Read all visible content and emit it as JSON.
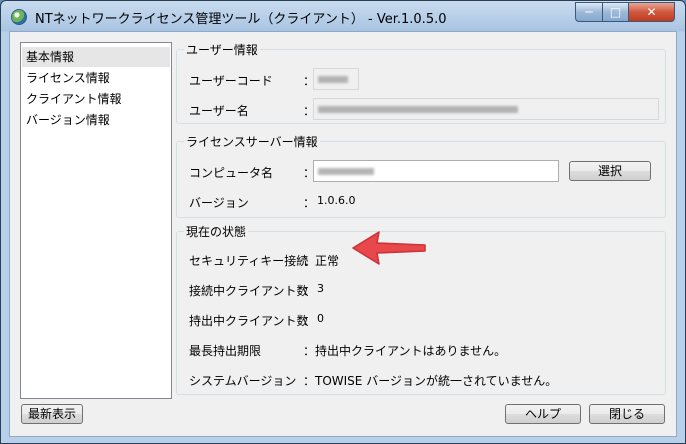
{
  "window": {
    "title": "NTネットワークライセンス管理ツール（クライアント） - Ver.1.0.5.0",
    "controls": {
      "minimize": "─",
      "maximize": "□",
      "close": "✕"
    }
  },
  "sidebar": {
    "items": [
      {
        "label": "基本情報"
      },
      {
        "label": "ライセンス情報"
      },
      {
        "label": "クライアント情報"
      },
      {
        "label": "バージョン情報"
      }
    ]
  },
  "user_info": {
    "legend": "ユーザー情報",
    "code_label": "ユーザーコード",
    "name_label": "ユーザー名",
    "colon": "："
  },
  "license_server": {
    "legend": "ライセンスサーバー情報",
    "computer_label": "コンピュータ名",
    "select_button": "選択",
    "version_label": "バージョン",
    "version_value": "1.0.6.0"
  },
  "status": {
    "legend": "現在の状態",
    "rows": [
      {
        "label": "セキュリティキー接続",
        "value": "正常"
      },
      {
        "label": "接続中クライアント数",
        "value": "3"
      },
      {
        "label": "持出中クライアント数",
        "value": "0"
      },
      {
        "label": "最長持出期限",
        "value": "持出中クライアントはありません。"
      },
      {
        "label": "システムバージョン",
        "value": "TOWISE バージョンが統一されていません。"
      }
    ]
  },
  "footer": {
    "refresh_button": "最新表示",
    "help_button": "ヘルプ",
    "close_button": "閉じる"
  },
  "colors": {
    "arrow": "#e8474b",
    "title_bar": "#a9c4e2"
  }
}
